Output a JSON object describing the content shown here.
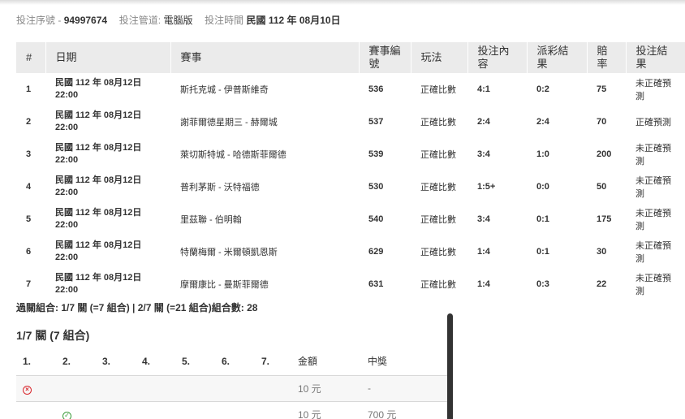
{
  "header": {
    "serial_label": "投注序號 -",
    "serial_value": "94997674",
    "channel_label": "投注管道:",
    "channel_value": "電腦版",
    "time_label": "投注時間",
    "time_value": "民國 112 年 08月10日"
  },
  "bets_table": {
    "columns": [
      "#",
      "日期",
      "賽事",
      "賽事編號",
      "玩法",
      "投注內容",
      "派彩結果",
      "賠率",
      "投注結果"
    ],
    "rows": [
      {
        "no": "1",
        "date": "民國 112 年 08月12日",
        "time": "22:00",
        "match": "斯托克城 - 伊普斯維奇",
        "code": "536",
        "play": "正確比數",
        "pick": "4:1",
        "result": "0:2",
        "odds": "75",
        "outcome": "未正確預測"
      },
      {
        "no": "2",
        "date": "民國 112 年 08月12日",
        "time": "22:00",
        "match": "謝菲爾德星期三 - 赫爾城",
        "code": "537",
        "play": "正確比數",
        "pick": "2:4",
        "result": "2:4",
        "odds": "70",
        "outcome": "正確預測"
      },
      {
        "no": "3",
        "date": "民國 112 年 08月12日",
        "time": "22:00",
        "match": "萊切斯特城 - 哈德斯菲爾德",
        "code": "539",
        "play": "正確比數",
        "pick": "3:4",
        "result": "1:0",
        "odds": "200",
        "outcome": "未正確預測"
      },
      {
        "no": "4",
        "date": "民國 112 年 08月12日",
        "time": "22:00",
        "match": "普利茅斯 - 沃特福德",
        "code": "530",
        "play": "正確比數",
        "pick": "1:5+",
        "result": "0:0",
        "odds": "50",
        "outcome": "未正確預測"
      },
      {
        "no": "5",
        "date": "民國 112 年 08月12日",
        "time": "22:00",
        "match": "里茲聯 - 伯明翰",
        "code": "540",
        "play": "正確比數",
        "pick": "3:4",
        "result": "0:1",
        "odds": "175",
        "outcome": "未正確預測"
      },
      {
        "no": "6",
        "date": "民國 112 年 08月12日",
        "time": "22:00",
        "match": "特蘭梅爾 - 米爾頓凱恩斯",
        "code": "629",
        "play": "正確比數",
        "pick": "1:4",
        "result": "0:1",
        "odds": "30",
        "outcome": "未正確預測"
      },
      {
        "no": "7",
        "date": "民國 112 年 08月12日",
        "time": "22:00",
        "match": "摩爾康比 - 曼斯菲爾德",
        "code": "631",
        "play": "正確比數",
        "pick": "1:4",
        "result": "0:3",
        "odds": "22",
        "outcome": "未正確預測"
      }
    ]
  },
  "combo_summary": "過關組合: 1/7 關 (=7 組合) | 2/7 關 (=21 組合)組合數: 28",
  "section": {
    "title": "1/7 關 (7 組合)",
    "columns": [
      "1.",
      "2.",
      "3.",
      "4.",
      "5.",
      "6.",
      "7.",
      "金額",
      "中獎"
    ],
    "rows": [
      {
        "icon": "lose-icon",
        "icon_col": 1,
        "amount": "10 元",
        "prize": "-"
      },
      {
        "icon": "win-icon",
        "icon_col": 2,
        "amount": "10 元",
        "prize": "700 元"
      }
    ]
  }
}
